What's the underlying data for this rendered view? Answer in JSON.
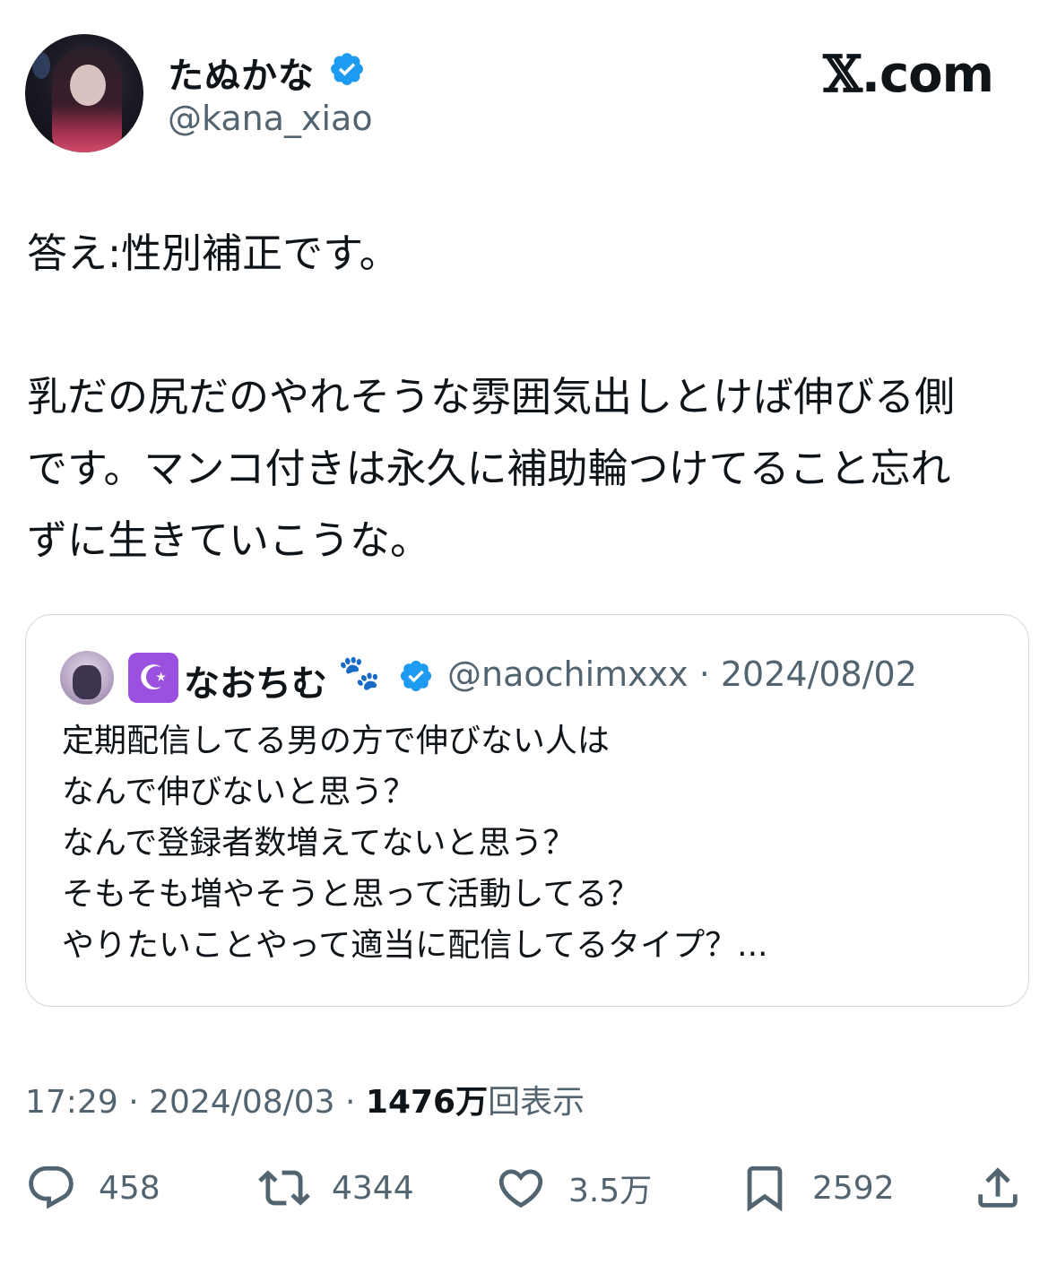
{
  "author": {
    "display_name": "たぬかな",
    "handle": "@kana_xiao"
  },
  "brand": {
    "x_glyph": "𝕏",
    "suffix": ".com"
  },
  "tweet": {
    "paragraphs": [
      "答え:性別補正です。",
      "乳だの尻だのやれそうな雰囲気出しとけば伸びる側",
      "です。マンコ付きは永久に補助輪つけてること忘れ",
      "ずに生きていこうな。"
    ]
  },
  "quote": {
    "emoji": "☪",
    "name": "なおちむ",
    "paw": "🐾",
    "handle_date": "@naochimxxx · 2024/08/02",
    "lines": [
      "定期配信してる男の方で伸びない人は",
      "なんで伸びないと思う？",
      "なんで登録者数増えてないと思う？",
      "そもそも増やそうと思って活動してる？",
      "やりたいことやって適当に配信してるタイプ？..."
    ]
  },
  "meta": {
    "time_date": "17:29 · 2024/08/03 · ",
    "views_count": "1476万",
    "views_label": "回表示"
  },
  "actions": {
    "replies": "458",
    "reposts": "4344",
    "likes": "3.5万",
    "bookmarks": "2592"
  },
  "colors": {
    "verified_blue": "#1d9bf0",
    "secondary_text": "#536471",
    "border": "#cfd9de"
  }
}
